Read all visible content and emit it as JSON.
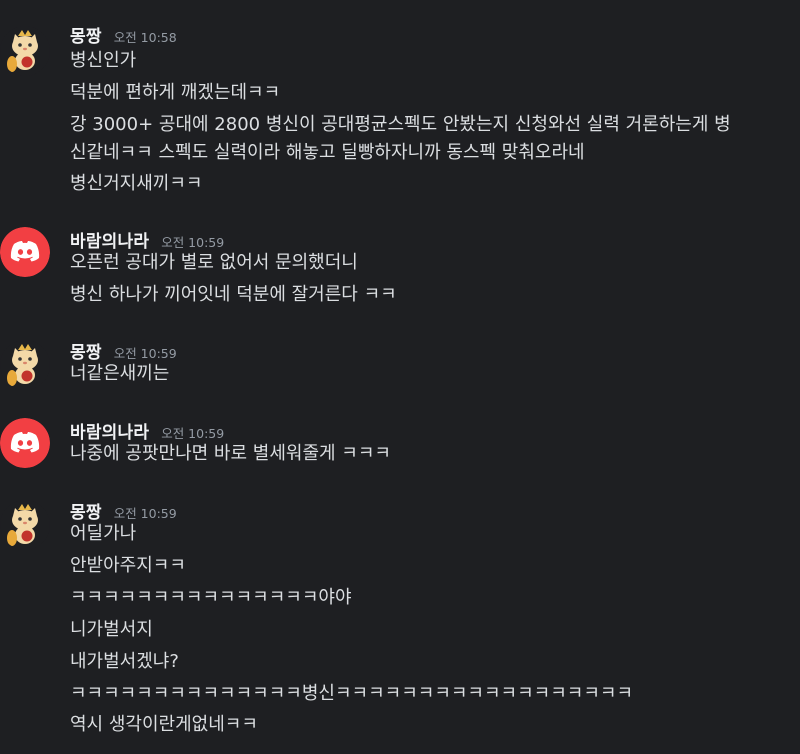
{
  "users": {
    "mongjjang": {
      "name": "몽짱",
      "avatar_icon": "cat-with-crown-icon"
    },
    "baram": {
      "name": "바람의나라",
      "avatar_icon": "discord-logo-icon",
      "avatar_color": "#f23f43"
    }
  },
  "groups": [
    {
      "author": "몽짱",
      "time": "오전 10:58",
      "messages": [
        "병신인가",
        "덕분에 편하게 깨겠는데ㅋㅋ",
        "강 3000+ 공대에 2800 병신이 공대평균스펙도 안봤는지 신청와선 실력 거론하는게 병",
        "신같네ㅋㅋ 스펙도 실력이라 해놓고 딜빵하자니까 동스펙 맞춰오라네",
        "병신거지새끼ㅋㅋ"
      ]
    },
    {
      "author": "바람의나라",
      "time": "오전 10:59",
      "messages": [
        "오픈런 공대가 별로 없어서 문의했더니",
        "병신 하나가 끼어잇네 덕분에 잘거른다 ㅋㅋ"
      ]
    },
    {
      "author": "몽짱",
      "time": "오전 10:59",
      "messages": [
        "너같은새끼는"
      ]
    },
    {
      "author": "바람의나라",
      "time": "오전 10:59",
      "messages": [
        "나중에 공팟만나면 바로 별세워줄게 ㅋㅋㅋ"
      ]
    },
    {
      "author": "몽짱",
      "time": "오전 10:59",
      "messages": [
        "어딜가나",
        "안받아주지ㅋㅋ",
        "ㅋㅋㅋㅋㅋㅋㅋㅋㅋㅋㅋㅋㅋㅋㅋ야야",
        "니가벌서지",
        "내가벌서겠냐?",
        "ㅋㅋㅋㅋㅋㅋㅋㅋㅋㅋㅋㅋㅋㅋ병신ㅋㅋㅋㅋㅋㅋㅋㅋㅋㅋㅋㅋㅋㅋㅋㅋㅋㅋ",
        "역시 생각이란게없네ㅋㅋ"
      ]
    }
  ],
  "colors": {
    "background": "#1e1f22",
    "username": "#f2f3f5",
    "timestamp": "#949ba4",
    "message": "#dbdee1",
    "discord_red": "#f23f43"
  }
}
